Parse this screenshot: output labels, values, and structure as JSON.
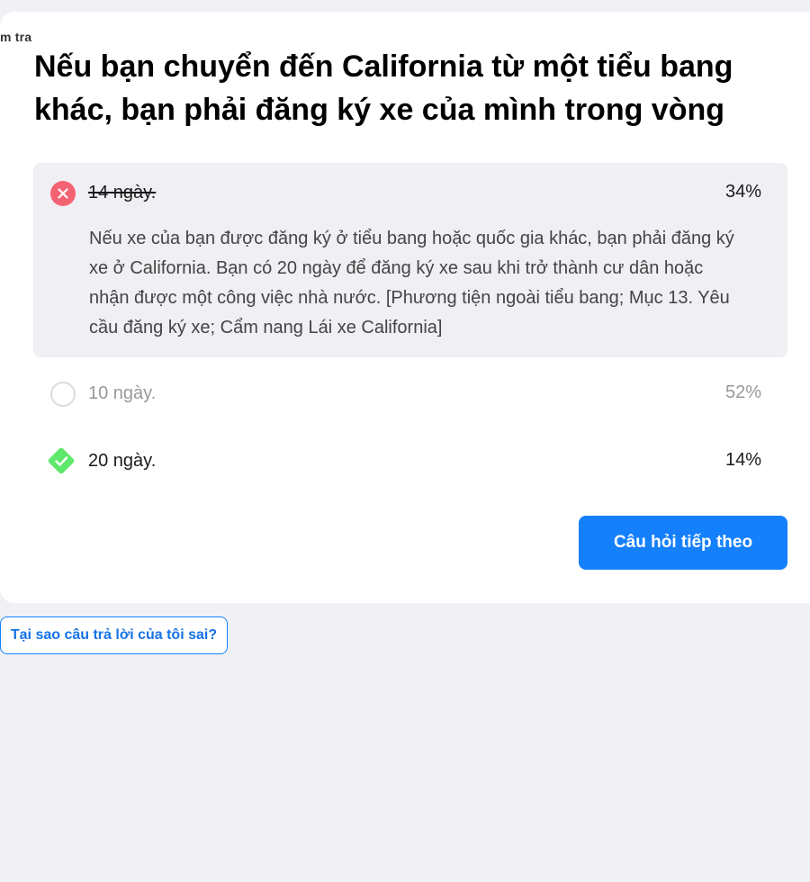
{
  "breadcrumb": "m tra",
  "question": "Nếu bạn chuyển đến California từ một tiểu bang khác, bạn phải đăng ký xe của mình trong vòng",
  "answers": [
    {
      "label": "14 ngày.",
      "percent": "34%",
      "state": "wrong",
      "icon": "x-circle-icon",
      "explanation": "Nếu xe của bạn được đăng ký ở tiểu bang hoặc quốc gia khác, bạn phải đăng ký xe ở California. Bạn có 20 ngày để đăng ký xe sau khi trở thành cư dân hoặc nhận được một công việc nhà nước. [Phương tiện ngoài tiểu bang; Mục 13. Yêu cầu đăng ký xe; Cẩm nang Lái xe California]"
    },
    {
      "label": "10 ngày.",
      "percent": "52%",
      "state": "neutral",
      "icon": "empty-circle-icon"
    },
    {
      "label": "20 ngày.",
      "percent": "14%",
      "state": "correct",
      "icon": "check-diamond-icon"
    }
  ],
  "buttons": {
    "next": "Câu hỏi tiếp theo",
    "why_wrong": "Tại sao câu trả lời của tôi sai?"
  },
  "colors": {
    "accent": "#1580fb",
    "wrong": "#f46371",
    "correct": "#5ee86c",
    "wrong_bg": "#efeff4",
    "page_bg": "#f0f0f5"
  }
}
